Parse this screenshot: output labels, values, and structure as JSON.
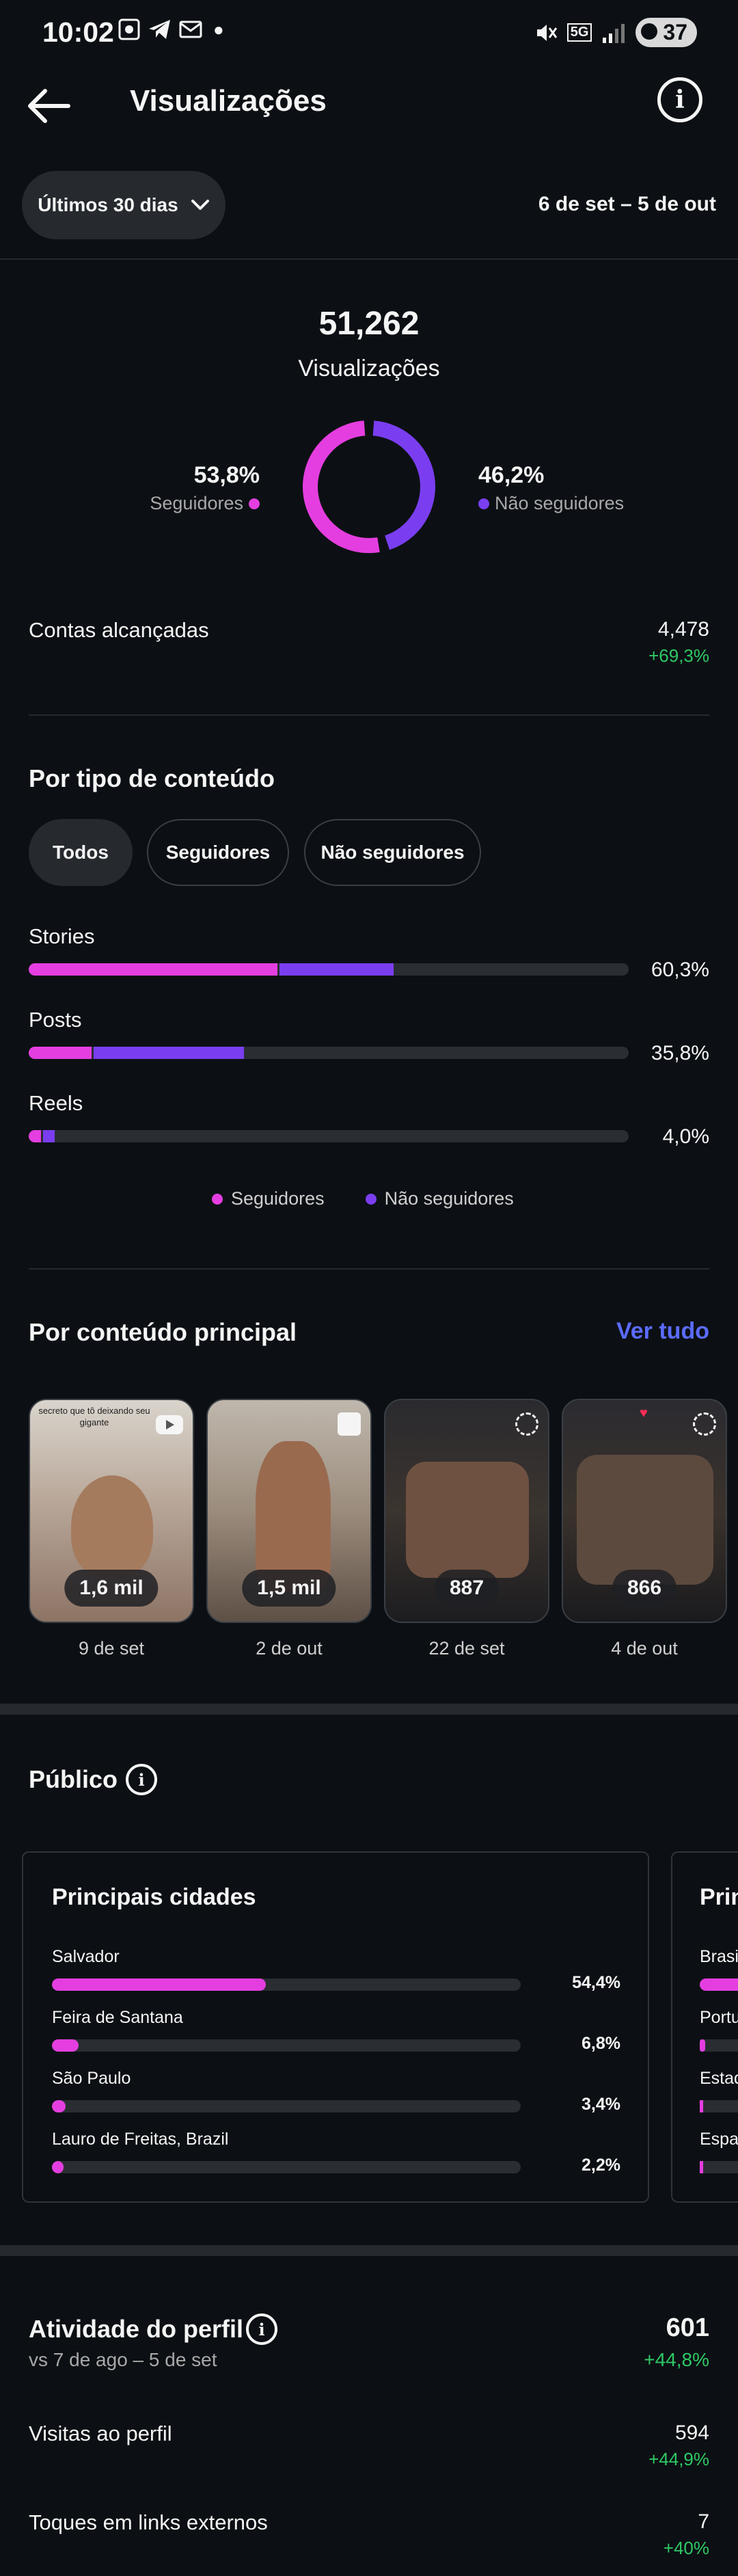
{
  "status_bar": {
    "time": "10:02",
    "battery": "37",
    "network": "5G"
  },
  "header": {
    "title": "Visualizações"
  },
  "filter": {
    "range_label": "Últimos 30 dias",
    "date_range": "6 de set – 5 de out"
  },
  "summary": {
    "total": "51,262",
    "total_label": "Visualizações",
    "followers_pct": "53,8%",
    "followers_label": "Seguidores",
    "non_followers_pct": "46,2%",
    "non_followers_label": "Não seguidores",
    "followers_fraction": 0.538
  },
  "accounts_reached": {
    "label": "Contas alcançadas",
    "value": "4,478",
    "change": "+69,3%"
  },
  "by_content_type": {
    "title": "Por tipo de conteúdo",
    "chips": [
      "Todos",
      "Seguidores",
      "Não seguidores"
    ],
    "rows": [
      {
        "label": "Stories",
        "value": "60,3%",
        "followers_frac": 0.415,
        "non_followers_frac": 0.19
      },
      {
        "label": "Posts",
        "value": "35,8%",
        "followers_frac": 0.105,
        "non_followers_frac": 0.25
      },
      {
        "label": "Reels",
        "value": "4,0%",
        "followers_frac": 0.02,
        "non_followers_frac": 0.02
      }
    ],
    "legend": [
      "Seguidores",
      "Não seguidores"
    ]
  },
  "top_content": {
    "title": "Por conteúdo principal",
    "see_all": "Ver tudo",
    "items": [
      {
        "count": "1,6 mil",
        "date": "9 de set",
        "caption": "secreto que tô deixando seu gigante"
      },
      {
        "count": "1,5 mil",
        "date": "2 de out"
      },
      {
        "count": "887",
        "date": "22 de set"
      },
      {
        "count": "866",
        "date": "4 de out"
      }
    ]
  },
  "audience": {
    "title": "Público",
    "cities_title": "Principais cidades",
    "cities": [
      {
        "label": "Salvador",
        "value": "54,4%",
        "frac": 0.544
      },
      {
        "label": "Feira de Santana",
        "value": "6,8%",
        "frac": 0.068
      },
      {
        "label": "São Paulo",
        "value": "3,4%",
        "frac": 0.034
      },
      {
        "label": "Lauro de Freitas, Brazil",
        "value": "2,2%",
        "frac": 0.022
      }
    ],
    "countries_title_partial": "Prin",
    "countries_partial": [
      "Brasi",
      "Portu",
      "Estad",
      "Espa"
    ]
  },
  "profile_activity": {
    "title": "Atividade do perfil",
    "subtitle": "vs 7 de ago – 5 de set",
    "total": "601",
    "total_change": "+44,8%",
    "rows": [
      {
        "label": "Visitas ao perfil",
        "value": "594",
        "change": "+44,9%"
      },
      {
        "label": "Toques em links externos",
        "value": "7",
        "change": "+40%"
      }
    ]
  },
  "colors": {
    "followers": "#e43ee0",
    "non_followers": "#7a3ef0",
    "positive": "#2fc965",
    "link": "#5b6bff"
  }
}
